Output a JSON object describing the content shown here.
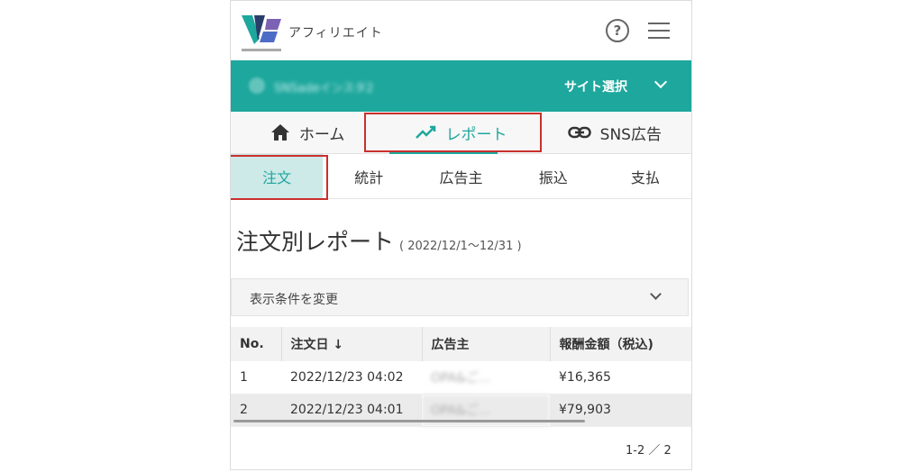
{
  "header": {
    "logo_text": "アフィリエイト",
    "help_symbol": "?"
  },
  "site_bar": {
    "site_name": "SNSadeインスタ2",
    "select_label": "サイト選択"
  },
  "main_tabs": [
    {
      "label": "ホーム",
      "icon": "home-icon"
    },
    {
      "label": "レポート",
      "icon": "chart-line-icon"
    },
    {
      "label": "SNS広告",
      "icon": "link-icon"
    }
  ],
  "sub_tabs": [
    {
      "label": "注文"
    },
    {
      "label": "統計"
    },
    {
      "label": "広告主"
    },
    {
      "label": "振込"
    },
    {
      "label": "支払"
    }
  ],
  "report": {
    "title": "注文別レポート",
    "period": "( 2022/12/1～12/31 )"
  },
  "filter": {
    "label": "表示条件を変更"
  },
  "table": {
    "headers": [
      "No.",
      "注文日 ↓",
      "広告主",
      "報酬金額（税込)"
    ],
    "rows": [
      {
        "no": "1",
        "date": "2022/12/23 04:02",
        "advertiser": "OPA&ご...",
        "amount": "¥16,365"
      },
      {
        "no": "2",
        "date": "2022/12/23 04:01",
        "advertiser": "OPA&ご...",
        "amount": "¥79,903"
      }
    ]
  },
  "pagination": "1-2 ／ 2",
  "colors": {
    "accent": "#1ea79d",
    "highlight_border": "#c9302c",
    "active_subtab_bg": "#cde9e8"
  }
}
